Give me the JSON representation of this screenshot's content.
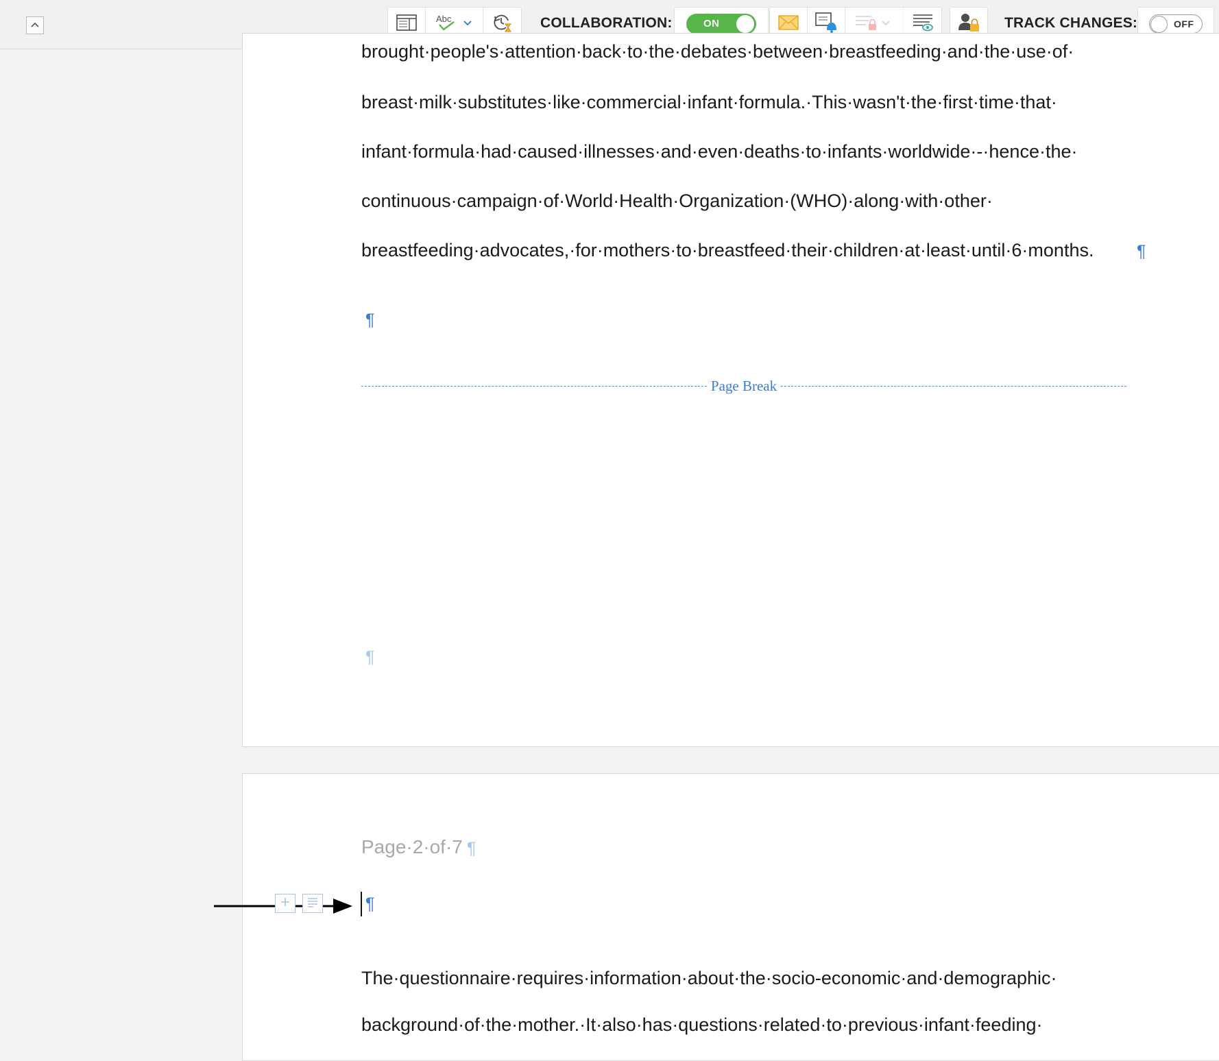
{
  "toolbar": {
    "collaboration_label": "COLLABORATION:",
    "collaboration_state": "ON",
    "track_changes_label": "TRACK CHANGES:",
    "track_changes_state": "OFF",
    "icons": [
      "chevron-up-icon",
      "layout-icon",
      "spellcheck-icon",
      "chevron-down-icon",
      "history-icon",
      "email-icon",
      "notify-icon",
      "lock-list-icon",
      "review-icon",
      "user-lock-icon"
    ],
    "colors": {
      "toggle_on": "#56b64a",
      "accent_blue": "#3a7bd5"
    }
  },
  "document": {
    "page1_lines": [
      "brought·people's·attention·back·to·the·debates·between·breastfeeding·and·the·use·of·",
      "breast·milk·substitutes·like·commercial·infant·formula.·This·wasn't·the·first·time·that·",
      "infant·formula·had·caused·illnesses·and·even·deaths·to·infants·worldwide·-·hence·the·",
      "continuous·campaign·of·World·Health·Organization·(WHO)·along·with·other·",
      "breastfeeding·advocates,·for·mothers·to·breastfeed·their·children·at·least·until·6·months."
    ],
    "pilcrow": "¶",
    "page_break_label": "Page Break",
    "page2_header": "Page·2·of·7",
    "page2_lines": [
      "The·questionnaire·requires·information·about·the·socio-economic·and·demographic·",
      "background·of·the·mother.·It·also·has·questions·related·to·previous·infant·feeding·"
    ]
  }
}
